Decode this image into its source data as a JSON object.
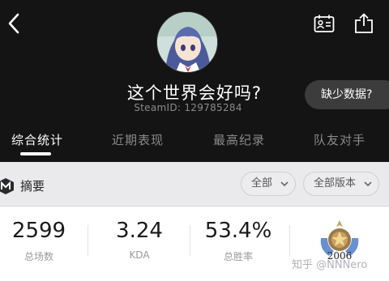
{
  "profile": {
    "username": "这个世界会好吗?",
    "steam_id": "SteamID: 129785284"
  },
  "missing_data_button": "缺少数据?",
  "tabs": [
    {
      "label": "综合统计",
      "active": true
    },
    {
      "label": "近期表现",
      "active": false
    },
    {
      "label": "最高纪录",
      "active": false
    },
    {
      "label": "队友对手",
      "active": false
    }
  ],
  "summary": {
    "label": "摘要",
    "filter_all": "全部",
    "filter_version": "全部版本"
  },
  "stats": [
    {
      "value": "2599",
      "label": "总场数"
    },
    {
      "value": "3.24",
      "label": "KDA"
    },
    {
      "value": "53.4%",
      "label": "总胜率"
    }
  ],
  "rank": {
    "score": "2006"
  },
  "watermark": "知乎 @NNNero",
  "colors": {
    "header_bg": "#141414",
    "panel_bg": "#f2f2f3",
    "text_primary": "#ffffff",
    "text_muted": "#8a8a8a"
  },
  "icons": [
    "back-arrow-icon",
    "id-card-icon",
    "share-icon",
    "summary-logo-icon",
    "chevron-down-icon",
    "rank-medal-icon"
  ]
}
